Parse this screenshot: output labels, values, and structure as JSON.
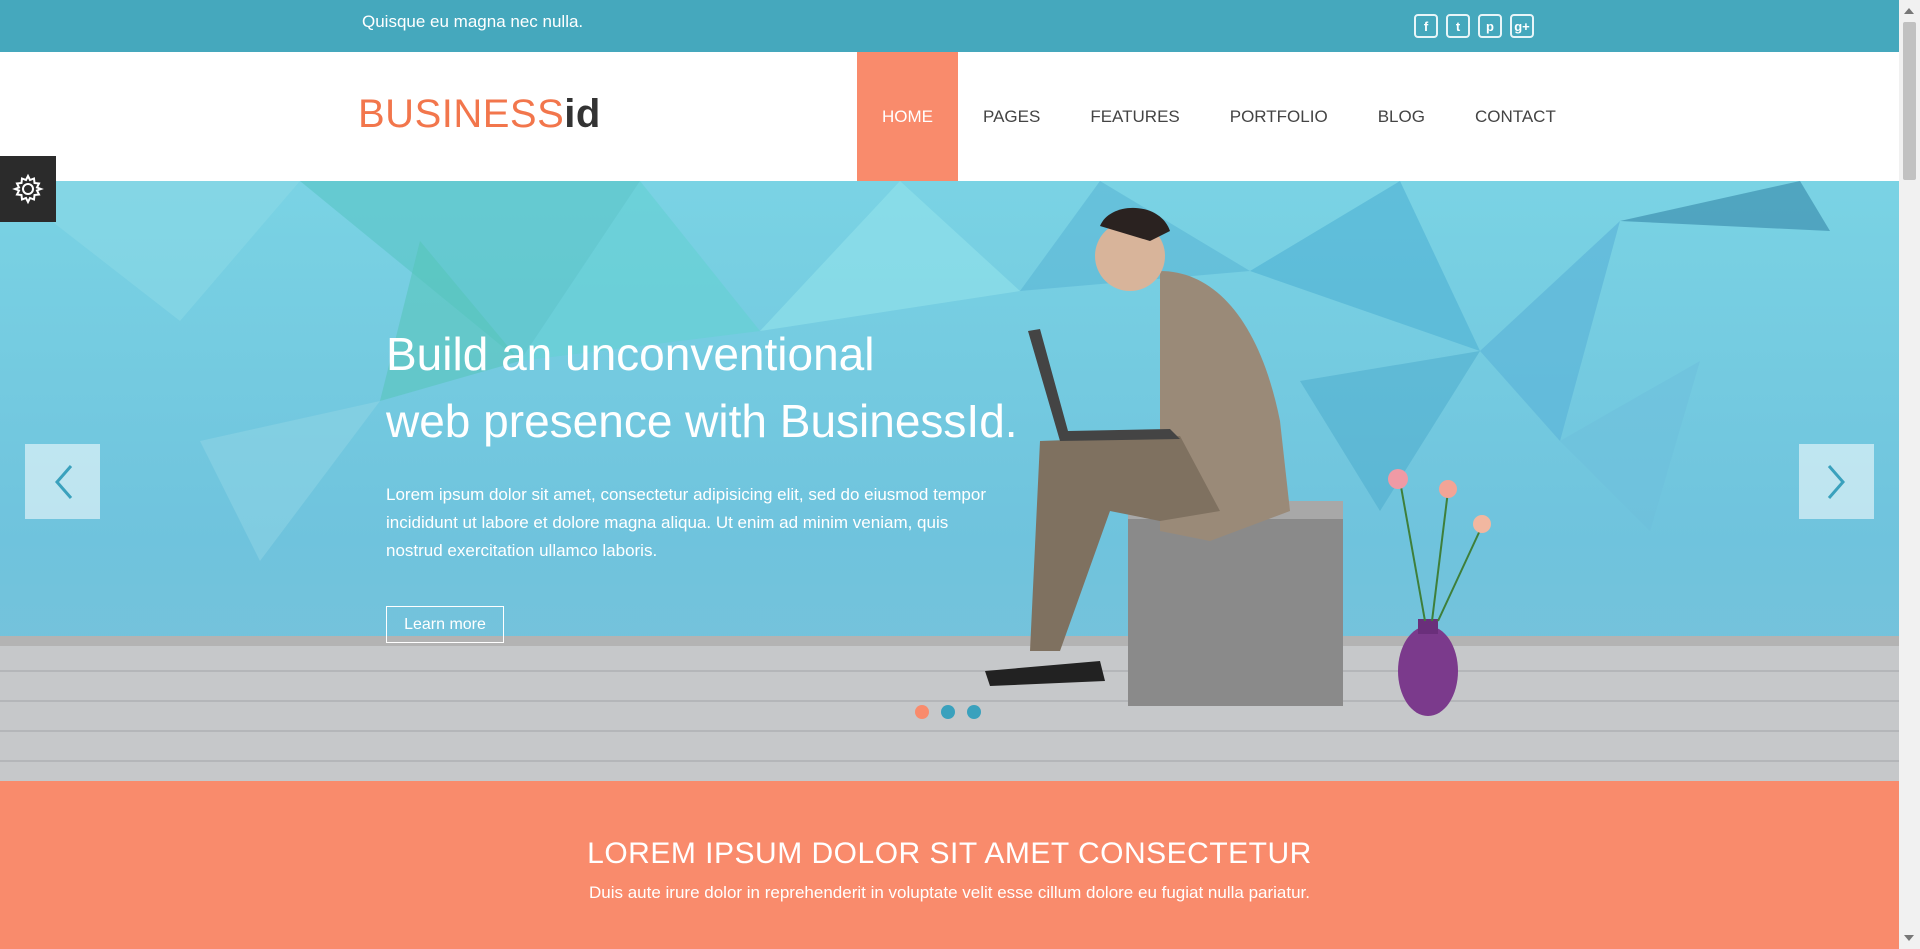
{
  "topbar": {
    "tagline": "Quisque eu magna nec nulla.",
    "social": [
      {
        "icon": "facebook-icon",
        "glyph": "f"
      },
      {
        "icon": "twitter-icon",
        "glyph": "t"
      },
      {
        "icon": "pinterest-icon",
        "glyph": "p"
      },
      {
        "icon": "google-plus-icon",
        "glyph": "g+"
      }
    ]
  },
  "logo": {
    "part1": "BUSINESS",
    "part2": "id"
  },
  "nav": {
    "home": "HOME",
    "pages": "PAGES",
    "features": "FEATURES",
    "portfolio": "PORTFOLIO",
    "blog": "BLOG",
    "contact": "CONTACT",
    "active": "HOME"
  },
  "hero": {
    "title_line1": "Build an unconventional",
    "title_line2": "web presence with BusinessId.",
    "description": "Lorem ipsum dolor sit amet, consectetur adipisicing elit, sed do eiusmod tempor incididunt ut labore et dolore magna aliqua. Ut enim ad minim veniam, quis nostrud exercitation ullamco laboris.",
    "button_label": "Learn more",
    "slides_total": 3,
    "active_slide": 1
  },
  "banner": {
    "heading": "LOREM IPSUM DOLOR SIT AMET CONSECTETUR",
    "text": "Duis aute irure dolor in reprehenderit in voluptate velit esse cillum dolore eu fugiat nulla pariatur."
  },
  "colors": {
    "accent": "#f98b6c",
    "topbar": "#45a8bd",
    "logo_primary": "#f2764c",
    "dot": "#3aa1bd"
  }
}
